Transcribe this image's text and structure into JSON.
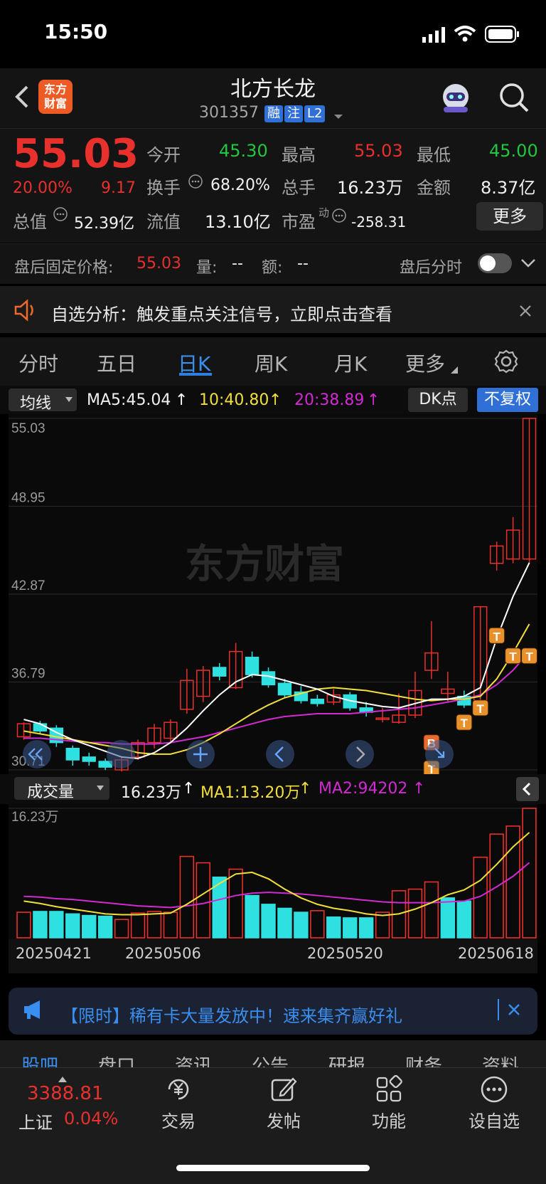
{
  "status": {
    "time": "15:50"
  },
  "header": {
    "logo_text_1": "东方",
    "logo_text_2": "财富",
    "title": "北方长龙",
    "code": "301357",
    "tags": [
      "融",
      "注",
      "L2"
    ]
  },
  "quote": {
    "price": "55.03",
    "pct": "20.00%",
    "change": "9.17",
    "labels": {
      "open": "今开",
      "high": "最高",
      "low": "最低",
      "turnover": "换手",
      "volume": "总手",
      "amount": "金额",
      "mktcap": "总值",
      "float_cap": "流值",
      "pe": "市盈",
      "pe_sup": "动"
    },
    "open": "45.30",
    "high": "55.03",
    "low": "45.00",
    "turnover": "68.20%",
    "volume": "16.23万",
    "amount": "8.37亿",
    "mktcap": "52.39亿",
    "float_cap": "13.10亿",
    "pe": "-258.31",
    "more": "更多"
  },
  "after_hours": {
    "label": "盘后固定价格:",
    "price": "55.03",
    "vol_label": "量:",
    "vol": "--",
    "amt_label": "额:",
    "amt": "--",
    "toggle_label": "盘后分时"
  },
  "alert": {
    "text": "自选分析：触发重点关注信号，立即点击查看"
  },
  "tabs": [
    "分时",
    "五日",
    "日K",
    "周K",
    "月K",
    "更多"
  ],
  "ma_bar": {
    "selector": "均线",
    "ma5": "MA5:45.04",
    "ma10": "10:40.80",
    "ma20": "20:38.89",
    "dk": "DK点",
    "adjust": "不复权"
  },
  "colors": {
    "up": "#e8302c",
    "down": "#2fe0e0",
    "ma5": "#ffffff",
    "ma10": "#f2df3a",
    "ma20": "#d22ad2",
    "accent": "#2f6fd6"
  },
  "chart_data": {
    "type": "candlestick",
    "y_ticks": [
      "55.03",
      "48.95",
      "42.87",
      "36.79",
      "30.71"
    ],
    "ylim": [
      30.71,
      55.03
    ],
    "watermark": "东方财富",
    "markers": [
      "B",
      "T",
      "T",
      "T",
      "T",
      "T",
      "T"
    ],
    "candles": [
      {
        "o": 33.0,
        "c": 33.9,
        "h": 34.0,
        "l": 32.8
      },
      {
        "o": 33.9,
        "c": 33.4,
        "h": 34.1,
        "l": 33.2
      },
      {
        "o": 33.6,
        "c": 32.6,
        "h": 33.8,
        "l": 32.3
      },
      {
        "o": 32.2,
        "c": 31.4,
        "h": 32.4,
        "l": 31.0
      },
      {
        "o": 31.6,
        "c": 31.3,
        "h": 31.9,
        "l": 31.0
      },
      {
        "o": 31.3,
        "c": 30.9,
        "h": 31.5,
        "l": 30.7
      },
      {
        "o": 30.71,
        "c": 31.4,
        "h": 31.6,
        "l": 30.6
      },
      {
        "o": 31.6,
        "c": 32.6,
        "h": 32.8,
        "l": 31.4
      },
      {
        "o": 32.6,
        "c": 33.6,
        "h": 33.9,
        "l": 32.2
      },
      {
        "o": 32.9,
        "c": 34.0,
        "h": 34.2,
        "l": 32.6
      },
      {
        "o": 34.9,
        "c": 36.9,
        "h": 37.7,
        "l": 34.6
      },
      {
        "o": 35.8,
        "c": 37.6,
        "h": 37.9,
        "l": 35.4
      },
      {
        "o": 37.8,
        "c": 37.2,
        "h": 38.1,
        "l": 36.9
      },
      {
        "o": 36.4,
        "c": 38.9,
        "h": 39.5,
        "l": 36.3
      },
      {
        "o": 38.5,
        "c": 37.3,
        "h": 38.9,
        "l": 37.1
      },
      {
        "o": 37.5,
        "c": 36.6,
        "h": 37.8,
        "l": 36.4
      },
      {
        "o": 36.7,
        "c": 35.9,
        "h": 37.0,
        "l": 35.7
      },
      {
        "o": 36.1,
        "c": 35.5,
        "h": 36.5,
        "l": 35.3
      },
      {
        "o": 35.6,
        "c": 35.3,
        "h": 35.9,
        "l": 35.1
      },
      {
        "o": 35.4,
        "c": 35.9,
        "h": 36.3,
        "l": 35.2
      },
      {
        "o": 35.9,
        "c": 35.0,
        "h": 36.1,
        "l": 34.8
      },
      {
        "o": 35.0,
        "c": 34.7,
        "h": 35.4,
        "l": 34.4
      },
      {
        "o": 34.3,
        "c": 34.3,
        "h": 35.0,
        "l": 34.0
      },
      {
        "o": 34.0,
        "c": 34.5,
        "h": 36.0,
        "l": 33.9
      },
      {
        "o": 34.5,
        "c": 36.2,
        "h": 37.5,
        "l": 34.3
      },
      {
        "o": 37.6,
        "c": 38.8,
        "h": 41.0,
        "l": 37.0
      },
      {
        "o": 36.0,
        "c": 36.3,
        "h": 37.5,
        "l": 35.4
      },
      {
        "o": 35.8,
        "c": 35.2,
        "h": 36.2,
        "l": 35.0
      },
      {
        "o": 35.3,
        "c": 42.0,
        "h": 42.0,
        "l": 35.0
      },
      {
        "o": 45.0,
        "c": 46.2,
        "h": 46.5,
        "l": 44.5
      },
      {
        "o": 45.3,
        "c": 47.3,
        "h": 48.2,
        "l": 45.0
      },
      {
        "o": 45.3,
        "c": 55.03,
        "h": 55.03,
        "l": 45.0
      }
    ],
    "ma5": [
      34.2,
      33.9,
      33.3,
      32.8,
      32.4,
      32.0,
      31.6,
      31.5,
      31.9,
      32.6,
      33.6,
      34.8,
      35.9,
      36.8,
      37.3,
      37.2,
      36.9,
      36.6,
      36.3,
      35.8,
      35.5,
      35.3,
      35.1,
      35.0,
      35.3,
      35.6,
      35.6,
      35.8,
      36.4,
      39.8,
      42.7,
      45.04
    ],
    "ma10": [
      33.4,
      33.2,
      33.0,
      32.8,
      32.6,
      32.4,
      32.2,
      31.9,
      31.8,
      31.8,
      32.1,
      32.6,
      33.2,
      33.9,
      34.6,
      35.2,
      35.7,
      36.0,
      36.3,
      36.4,
      36.3,
      36.2,
      36.0,
      35.8,
      35.6,
      35.5,
      35.6,
      35.6,
      35.8,
      37.0,
      38.8,
      40.8
    ],
    "ma20": [
      32.9,
      32.9,
      32.8,
      32.7,
      32.6,
      32.6,
      32.5,
      32.5,
      32.5,
      32.6,
      32.8,
      33.0,
      33.3,
      33.6,
      33.9,
      34.2,
      34.4,
      34.5,
      34.6,
      34.6,
      34.6,
      34.7,
      34.8,
      34.9,
      35.0,
      35.2,
      35.4,
      35.6,
      35.9,
      36.6,
      37.6,
      38.89
    ],
    "volume": {
      "label": "成交量",
      "value": "16.23万",
      "ma1": "MA1:13.20万",
      "ma2": "MA2:94202",
      "top_tick": "16.23万",
      "dates": [
        "20250421",
        "20250506",
        "20250520",
        "20250618"
      ],
      "bars": [
        3.2,
        3.3,
        3.3,
        3.0,
        2.8,
        2.7,
        2.3,
        3.1,
        3.3,
        3.2,
        10.2,
        9.4,
        7.6,
        8.6,
        5.3,
        4.2,
        3.7,
        3.2,
        3.4,
        2.6,
        2.5,
        2.5,
        3.2,
        5.9,
        6.1,
        7.0,
        5.0,
        4.6,
        10.1,
        13.0,
        14.0,
        16.23
      ],
      "up": [
        true,
        false,
        false,
        false,
        false,
        false,
        true,
        true,
        true,
        true,
        true,
        true,
        false,
        true,
        false,
        false,
        false,
        false,
        true,
        false,
        false,
        false,
        true,
        true,
        true,
        true,
        false,
        false,
        true,
        true,
        true,
        true
      ],
      "ma1_line": [
        4.6,
        4.3,
        3.9,
        3.6,
        3.3,
        3.0,
        2.9,
        2.9,
        3.0,
        3.1,
        4.2,
        5.5,
        6.8,
        8.0,
        8.2,
        7.4,
        6.1,
        5.0,
        4.2,
        3.7,
        3.4,
        3.0,
        2.8,
        3.0,
        3.6,
        4.4,
        5.4,
        6.0,
        7.2,
        9.2,
        11.4,
        13.2
      ],
      "ma2_line": [
        5.2,
        5.1,
        4.9,
        4.8,
        4.6,
        4.4,
        4.2,
        4.0,
        3.9,
        3.8,
        4.0,
        4.3,
        4.8,
        5.3,
        5.6,
        5.7,
        5.6,
        5.5,
        5.3,
        5.1,
        4.9,
        4.7,
        4.5,
        4.4,
        4.4,
        4.4,
        4.5,
        4.6,
        5.2,
        6.4,
        7.7,
        9.42
      ]
    }
  },
  "promo": {
    "text": "【限时】稀有卡大量发放中！速来集齐赢好礼"
  },
  "bottom_tabs": [
    "股吧",
    "盘口",
    "资讯",
    "公告",
    "研报",
    "财务",
    "资料"
  ],
  "bottom_nav": {
    "index_value": "3388.81",
    "index_name": "上证",
    "index_pct": "0.04%",
    "items": [
      "交易",
      "发帖",
      "功能",
      "设自选"
    ]
  }
}
